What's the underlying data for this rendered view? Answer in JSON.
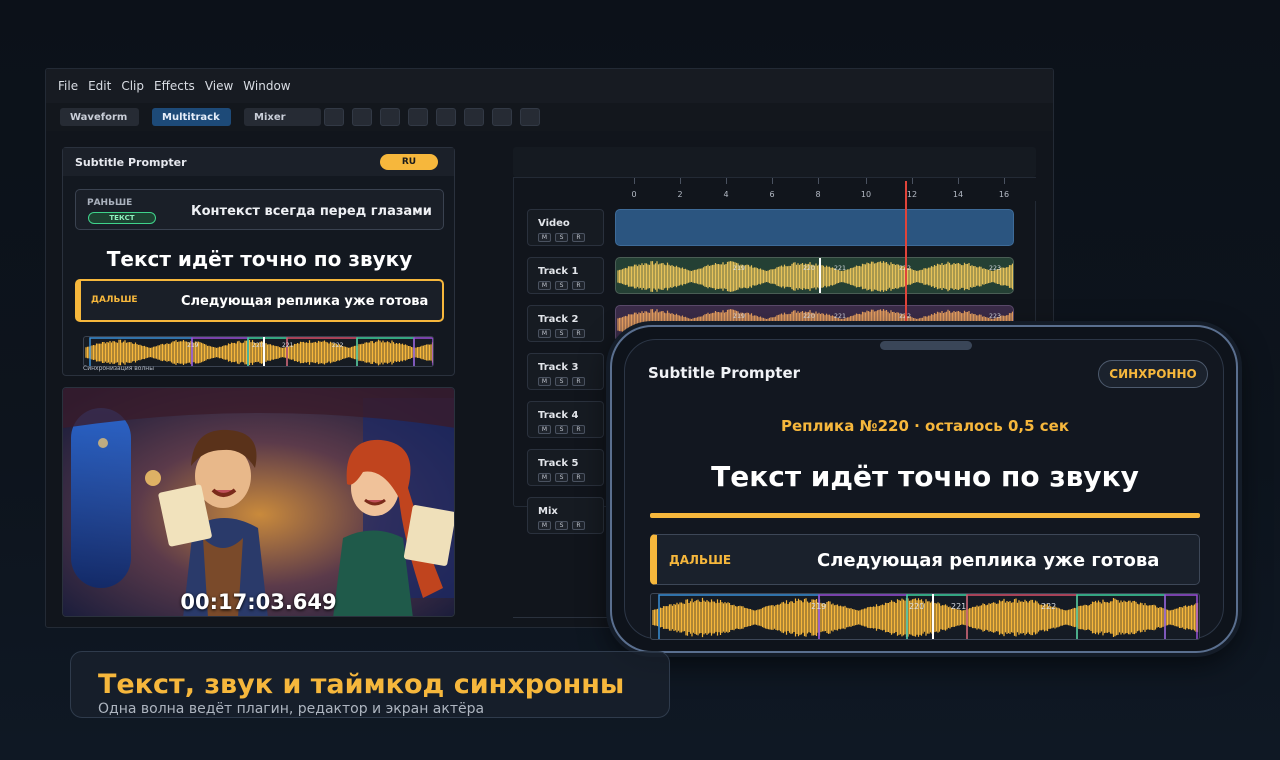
{
  "menu": [
    "File",
    "Edit",
    "Clip",
    "Effects",
    "View",
    "Window"
  ],
  "toolbar": {
    "tabs": [
      "Waveform",
      "Multitrack",
      "Mixer"
    ],
    "active": "Multitrack"
  },
  "prompter": {
    "title": "Subtitle Prompter",
    "lang": "RU",
    "prev_label": "РАНЬШЕ",
    "prev_tag": "ТЕКСТ",
    "prev_text": "Контекст всегда перед глазами",
    "current": "Текст идёт точно по звуку",
    "next_label": "ДАЛЬШЕ",
    "next_text": "Следующая реплика уже готова",
    "wave_caption": "Синхронизация волны",
    "wave_markers": [
      "219",
      "220",
      "221",
      "222"
    ]
  },
  "video": {
    "timecode": "00:17:03.649"
  },
  "timeline": {
    "ruler": [
      "0",
      "2",
      "4",
      "6",
      "8",
      "10",
      "12",
      "14",
      "16"
    ],
    "tracks": [
      {
        "name": "Video"
      },
      {
        "name": "Track 1"
      },
      {
        "name": "Track 2"
      },
      {
        "name": "Track 3"
      },
      {
        "name": "Track 4"
      },
      {
        "name": "Track 5"
      },
      {
        "name": "Mix"
      }
    ],
    "msr": [
      "M",
      "S",
      "R"
    ],
    "clip_markers": [
      "219",
      "220",
      "221",
      "222",
      "223"
    ]
  },
  "phone": {
    "title": "Subtitle Prompter",
    "status": "СИНХРОННО",
    "replica": "Реплика №220 · осталось 0,5 сек",
    "current": "Текст идёт точно по звуку",
    "next_label": "ДАЛЬШЕ",
    "next_text": "Следующая реплика уже готова",
    "wave_markers": [
      "219",
      "220",
      "221",
      "222"
    ]
  },
  "caption": {
    "title": "Текст, звук и таймкод синхронны",
    "subtitle": "Одна волна ведёт плагин, редактор и экран актёра"
  },
  "colors": {
    "accent": "#f6b73c",
    "active_tab": "#1d4a78",
    "playhead": "#e0443a"
  }
}
